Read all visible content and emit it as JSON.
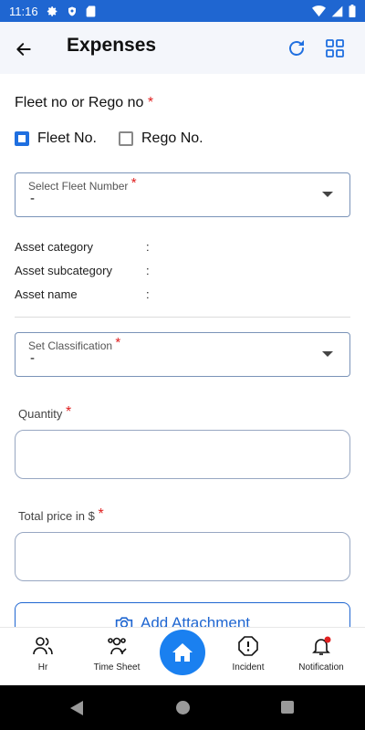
{
  "status_bar": {
    "time": "11:16",
    "icons": [
      "gear-icon",
      "shield-icon",
      "sd-card-icon",
      "wifi-icon",
      "signal-icon",
      "battery-icon"
    ]
  },
  "app_bar": {
    "title": "Expenses",
    "icons": [
      "back-arrow-icon",
      "refresh-icon",
      "grid-icon"
    ]
  },
  "form": {
    "fleet_label": "Fleet no or Rego no",
    "required_mark": "*",
    "fleet_option": {
      "label": "Fleet No.",
      "checked": true
    },
    "rego_option": {
      "label": "Rego No.",
      "checked": false
    },
    "fleet_number": {
      "label": "Select Fleet Number",
      "value": "-"
    },
    "asset_info": [
      {
        "label": "Asset category",
        "sep": ":",
        "value": ""
      },
      {
        "label": "Asset subcategory",
        "sep": ":",
        "value": ""
      },
      {
        "label": "Asset name",
        "sep": ":",
        "value": ""
      }
    ],
    "classification": {
      "label": "Set Classification",
      "value": "-"
    },
    "quantity": {
      "label": "Quantity",
      "value": ""
    },
    "total_price": {
      "label": "Total price in $",
      "value": ""
    },
    "attachment": {
      "label": "Add Attachment"
    }
  },
  "bottom_nav": {
    "items": [
      {
        "label": "Hr",
        "icon": "people-icon"
      },
      {
        "label": "Time Sheet",
        "icon": "timesheet-icon"
      },
      {
        "label": "",
        "icon": "home-icon"
      },
      {
        "label": "Incident",
        "icon": "alert-icon"
      },
      {
        "label": "Notification",
        "icon": "bell-icon"
      }
    ]
  },
  "colors": {
    "primary": "#1f66d1",
    "home_button": "#1a80f0",
    "required": "#e02020",
    "app_bar_bg": "#f4f6fb",
    "notification_dot": "#e02020"
  }
}
